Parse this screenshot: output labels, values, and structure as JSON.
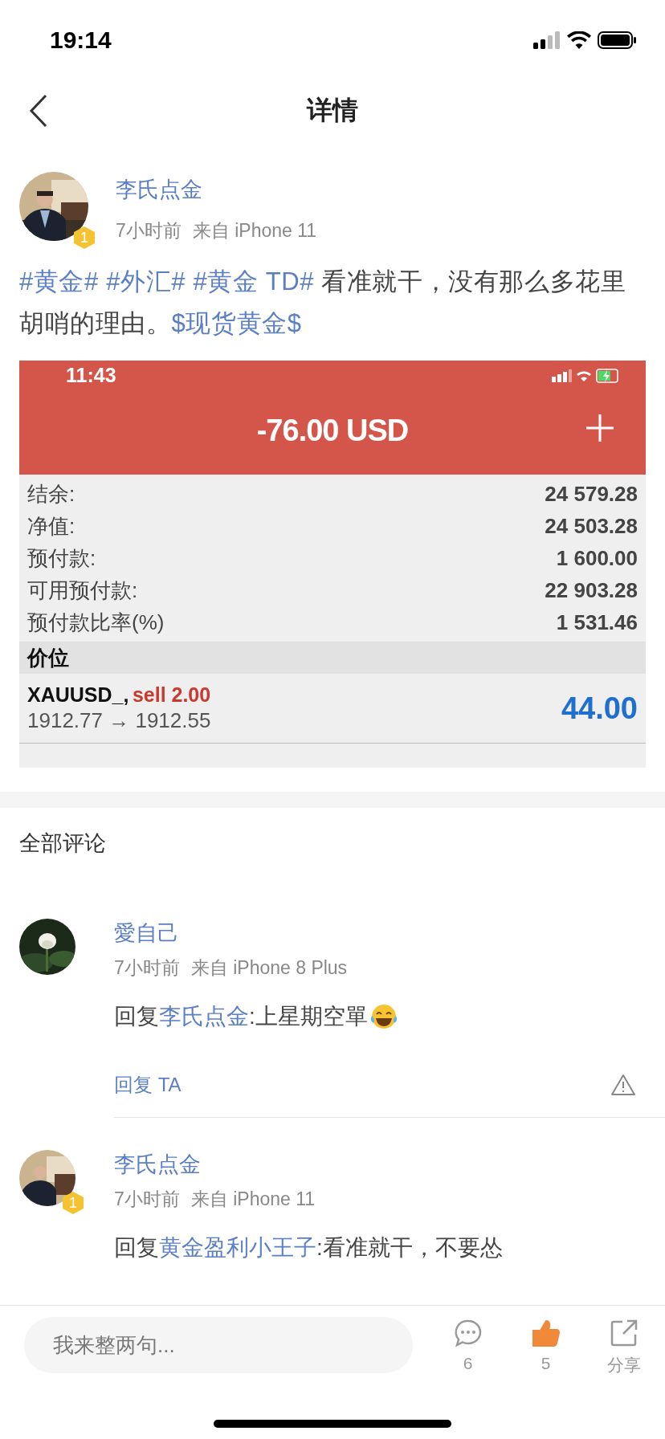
{
  "status_bar": {
    "time": "19:14"
  },
  "nav": {
    "title": "详情"
  },
  "post": {
    "author": "李氏点金",
    "author_badge": "1",
    "time": "7小时前",
    "source": "来自 iPhone 11",
    "segments": [
      {
        "kind": "link",
        "text": "#黄金#"
      },
      {
        "kind": "link",
        "text": "#外汇#"
      },
      {
        "kind": "link",
        "text": "#黄金 TD#"
      },
      {
        "kind": "plain",
        "text": "看准就干，没有那么多花里胡哨的理由。"
      },
      {
        "kind": "link",
        "text": "$现货黄金$"
      }
    ],
    "screenshot": {
      "time": "11:43",
      "title": "-76.00 USD",
      "rows": [
        {
          "label": "结余:",
          "value": "24 579.28"
        },
        {
          "label": "净值:",
          "value": "24 503.28"
        },
        {
          "label": "预付款:",
          "value": "1 600.00"
        },
        {
          "label": "可用预付款:",
          "value": "22 903.28"
        },
        {
          "label": "预付款比率(%)",
          "value": "1 531.46"
        }
      ],
      "section": "价位",
      "position": {
        "symbol": "XAUUSD_,",
        "side": "sell 2.00",
        "prices": "1912.77 → 1912.55",
        "profit": "44.00"
      }
    }
  },
  "comments_title": "全部评论",
  "comments": [
    {
      "author": "愛自己",
      "time": "7小时前",
      "source": "来自 iPhone 8 Plus",
      "prefix": "回复",
      "reply_to": "李氏点金",
      "text": ":上星期空單",
      "emoji": true,
      "action": "回复 TA"
    },
    {
      "author": "李氏点金",
      "badge": "1",
      "time": "7小时前",
      "source": "来自 iPhone 11",
      "prefix": "回复",
      "reply_to": "黄金盈利小王子",
      "text": ":看准就干，不要怂",
      "emoji": false
    }
  ],
  "bottom_bar": {
    "placeholder": "我来整两句...",
    "comment_count": "6",
    "like_count": "5",
    "liked": true,
    "share": "分享"
  }
}
